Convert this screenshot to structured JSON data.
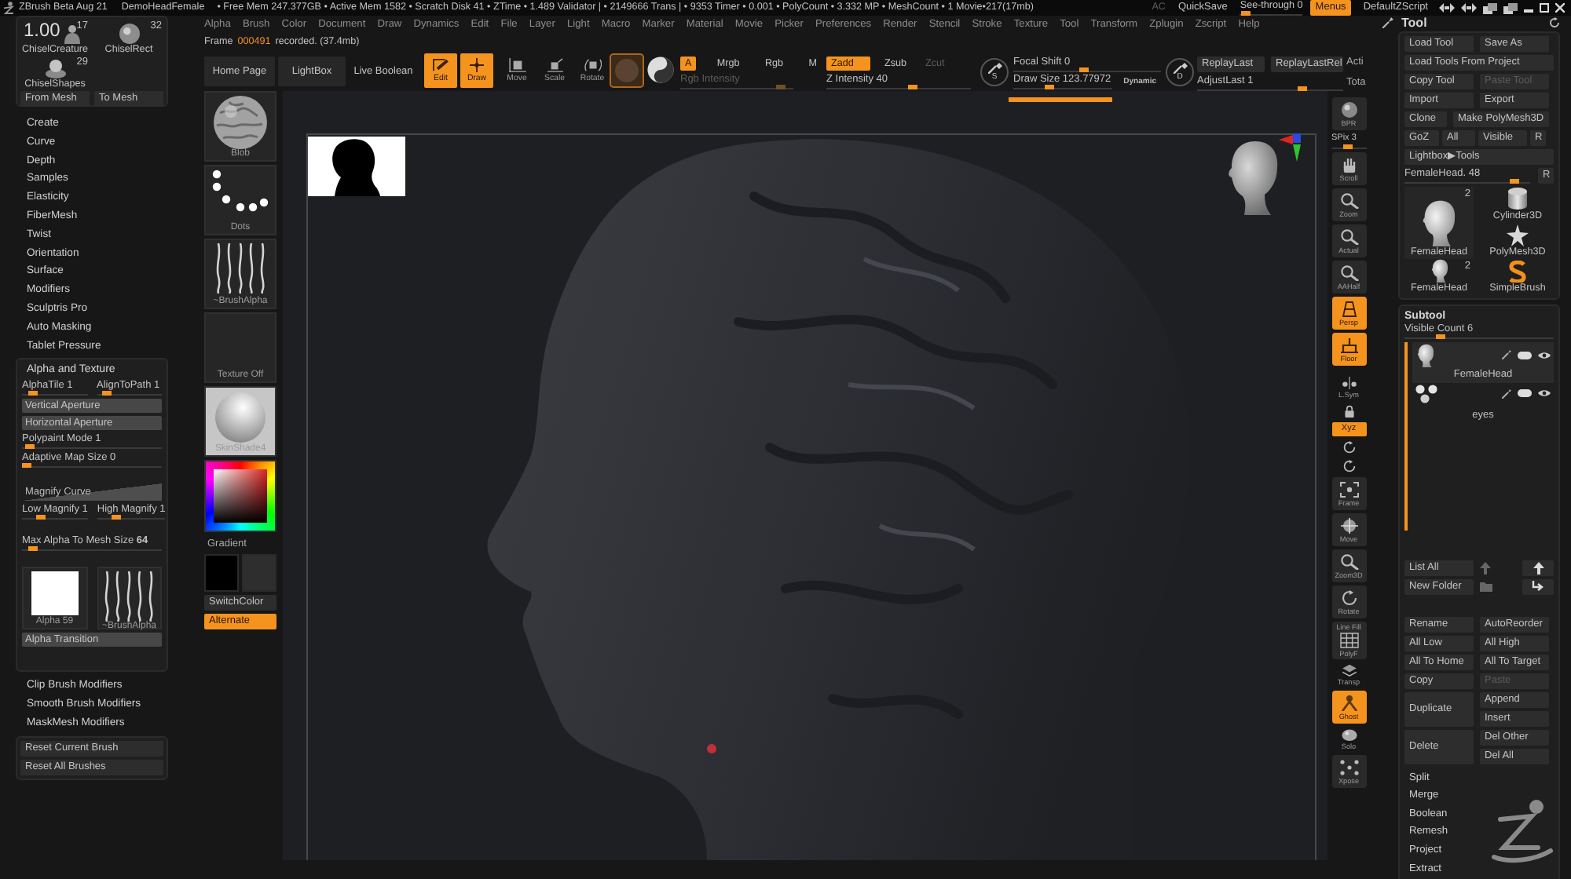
{
  "title_bar": {
    "app": "ZBrush Beta Aug 21",
    "document": "DemoHeadFemale",
    "stats": "• Free Mem 247.377GB • Active Mem 1582 • Scratch Disk 41 •  ZTime • 1.489 Validator | • 2149666 Trans | • 9353 Timer • 0.001 • PolyCount • 3.332 MP • MeshCount • 1  Movie•217(17mb)",
    "controls": [
      {
        "kind": "label",
        "label": "AC",
        "disabled": true
      },
      {
        "kind": "button",
        "label": "QuickSave",
        "on": false
      },
      {
        "kind": "slider",
        "label": "See-through 0",
        "level": 0.03
      },
      {
        "kind": "button",
        "label": "Menus",
        "on": true
      },
      {
        "kind": "button",
        "label": "DefaultZScript",
        "on": false
      }
    ]
  },
  "menu": [
    "Alpha",
    "Brush",
    "Color",
    "Document",
    "Draw",
    "Dynamics",
    "Edit",
    "File",
    "Layer",
    "Light",
    "Macro",
    "Marker",
    "Material",
    "Movie",
    "Picker",
    "Preferences",
    "Render",
    "Stencil",
    "Stroke",
    "Texture",
    "Tool",
    "Transform",
    "Zplugin",
    "Zscript",
    "Help"
  ],
  "frame_status": {
    "label": "Frame",
    "number": "000491",
    "note": "recorded. (37.4mb)"
  },
  "left_panel": {
    "readout": "1.00",
    "tools": [
      {
        "label": "ChiselCreature",
        "count": "17"
      },
      {
        "label": "ChiselRect",
        "count": "32"
      },
      {
        "label": "ChiselShapes",
        "count": "29"
      }
    ],
    "mesh_buttons": [
      "From Mesh",
      "To Mesh"
    ],
    "brush_menu": [
      "Create",
      "Curve",
      "Depth",
      "Samples",
      "Elasticity",
      "FiberMesh",
      "Twist",
      "Orientation",
      "Surface",
      "Modifiers",
      "Sculptris Pro",
      "Auto Masking",
      "Tablet Pressure"
    ],
    "alpha_texture": {
      "title": "Alpha and Texture",
      "rows": [
        [
          {
            "kind": "slider",
            "label": "AlphaTile 1",
            "level": 0.1
          },
          {
            "kind": "slider",
            "label": "AlignToPath 1",
            "level": 0.1
          }
        ],
        [
          {
            "kind": "bar",
            "label": "Vertical Aperture"
          }
        ],
        [
          {
            "kind": "bar",
            "label": "Horizontal Aperture"
          }
        ],
        [
          {
            "kind": "slider",
            "label": "Polypaint Mode 1",
            "level": 0.02
          }
        ],
        [
          {
            "kind": "slider",
            "label": "Adaptive Map Size 0",
            "level": 0.0
          }
        ],
        [
          {
            "kind": "curve",
            "label": "Magnify Curve"
          }
        ],
        [
          {
            "kind": "slider",
            "label": "Low Magnify 1",
            "level": 0.25
          },
          {
            "kind": "slider",
            "label": "High Magnify 1",
            "level": 0.25
          }
        ],
        [
          {
            "kind": "slider",
            "label": "Max Alpha To Mesh Size **64**",
            "level": 0.05
          }
        ],
        [
          {
            "kind": "solid",
            "label": "Alpha 59"
          },
          {
            "kind": "alpha",
            "label": "~BrushAlpha"
          }
        ],
        [
          {
            "kind": "bar",
            "label": "Alpha Transition"
          }
        ]
      ]
    },
    "modifiers": [
      "Clip Brush Modifiers",
      "Smooth Brush Modifiers",
      "MaskMesh Modifiers"
    ],
    "reset_buttons": [
      "Reset Current Brush",
      "Reset All Brushes"
    ]
  },
  "shelf": {
    "buttons": [
      {
        "kind": "button",
        "label": "Home Page"
      },
      {
        "kind": "button",
        "label": "LightBox"
      },
      {
        "kind": "plain",
        "label": "Live Boolean"
      }
    ],
    "modes": [
      {
        "label": "Edit",
        "selected": true
      },
      {
        "label": "Draw",
        "selected": true
      },
      {
        "label": "Move",
        "selected": false
      },
      {
        "label": "Scale",
        "selected": false
      },
      {
        "label": "Rotate",
        "selected": false
      }
    ],
    "color_modes": [
      {
        "label": "A",
        "selected": true
      },
      {
        "label": "Mrgb",
        "selected": false
      },
      {
        "label": "Rgb",
        "selected": false
      },
      {
        "label": "M",
        "selected": false
      }
    ],
    "rgb_intensity": {
      "label": "Rgb Intensity",
      "level": 0.92,
      "disabled": true
    },
    "sculpt_modes": [
      {
        "label": "Zadd",
        "selected": true,
        "disabled": false
      },
      {
        "label": "Zsub",
        "selected": false,
        "disabled": false
      },
      {
        "label": "Zcut",
        "selected": false,
        "disabled": true
      }
    ],
    "z_intensity": {
      "label": "Z Intensity 40",
      "level": 0.6
    },
    "stroke_button": "S",
    "focal_shift": {
      "label": "Focal Shift 0",
      "level": 0.48
    },
    "draw_size": {
      "label": "Draw Size 123.77972",
      "level": 0.35
    },
    "dynamic": "Dynamic",
    "alpha_button": "D",
    "replay_buttons": [
      "ReplayLast",
      "ReplayLastRel"
    ],
    "adjust_last": {
      "label": "AdjustLast 1",
      "level": 0.74
    },
    "cut_labels": [
      "Acti",
      "Tota"
    ]
  },
  "left_shelf": [
    {
      "kind": "brush",
      "label": "Blob"
    },
    {
      "kind": "stroke",
      "label": "Dots"
    },
    {
      "kind": "alpha",
      "label": "~BrushAlpha"
    },
    {
      "kind": "texture",
      "label": "Texture Off"
    },
    {
      "kind": "material",
      "label": "SkinShade4"
    },
    {
      "kind": "picker"
    },
    {
      "kind": "label",
      "label": "Gradient"
    },
    {
      "kind": "swatches",
      "swatches": [
        {
          "color": "#000000"
        },
        {
          "color": "#2e2e2e"
        }
      ]
    },
    {
      "kind": "button",
      "label": "SwitchColor",
      "on": false
    },
    {
      "kind": "button",
      "label": "Alternate",
      "on": true
    }
  ],
  "right_shelf": [
    {
      "kind": "tile",
      "label": "BPR",
      "selected": false
    },
    {
      "kind": "slider",
      "label": "SPix 3",
      "level": 0.45
    },
    {
      "kind": "tile",
      "label": "Scroll",
      "selected": false
    },
    {
      "kind": "tile",
      "label": "Zoom",
      "selected": false
    },
    {
      "kind": "tile",
      "label": "Actual",
      "selected": false
    },
    {
      "kind": "tile",
      "label": "AAHalf",
      "selected": false
    },
    {
      "kind": "tile",
      "label": "Persp",
      "selected": true
    },
    {
      "kind": "tile",
      "label": "Floor",
      "selected": true
    },
    {
      "kind": "small",
      "label": "L.Sym",
      "selected": false
    },
    {
      "kind": "small",
      "selected": false
    },
    {
      "kind": "chip",
      "label": "Xyz",
      "selected": true
    },
    {
      "kind": "small",
      "selected": false
    },
    {
      "kind": "small",
      "selected": false
    },
    {
      "kind": "tile",
      "label": "Frame",
      "selected": false
    },
    {
      "kind": "tile",
      "label": "Move",
      "selected": false
    },
    {
      "kind": "tile",
      "label": "Zoom3D",
      "selected": false
    },
    {
      "kind": "tile",
      "label": "Rotate",
      "selected": false
    },
    {
      "kind": "tile",
      "caption": "Line Fill",
      "label": "PolyF",
      "selected": false
    },
    {
      "kind": "small",
      "label": "Transp",
      "selected": false
    },
    {
      "kind": "tile",
      "label": "Ghost",
      "selected": true
    },
    {
      "kind": "small",
      "label": "Solo",
      "selected": false
    },
    {
      "kind": "tile",
      "label": "Xpose",
      "selected": false
    }
  ],
  "tool_palette": {
    "title": "Tool",
    "rows": [
      [
        {
          "label": "Load Tool",
          "disabled": false
        },
        {
          "label": "Save As",
          "disabled": false
        }
      ],
      [
        {
          "label": "Load Tools From Project",
          "disabled": false
        }
      ],
      [
        {
          "label": "Copy Tool",
          "disabled": false
        },
        {
          "label": "Paste Tool",
          "disabled": true
        }
      ],
      [
        {
          "label": "Import",
          "disabled": false
        },
        {
          "label": "Export",
          "disabled": false
        }
      ],
      [
        {
          "label": "Clone",
          "disabled": false
        },
        {
          "label": "Make PolyMesh3D",
          "disabled": false
        }
      ],
      [
        {
          "label": "GoZ",
          "disabled": false
        },
        {
          "label": "All",
          "disabled": false
        },
        {
          "label": "Visible",
          "disabled": false
        },
        {
          "label": "R",
          "disabled": false
        }
      ],
      [
        {
          "label": "Lightbox▶Tools",
          "disabled": false
        }
      ]
    ],
    "tool_slider": {
      "label": "FemaleHead. 48",
      "level": 0.9
    },
    "tool_slider_button": "R",
    "thumbs": [
      {
        "kind": "head",
        "label": "FemaleHead",
        "count": "2",
        "selected": true
      },
      {
        "kind": "cylinder",
        "label": "Cylinder3D",
        "selected": false
      },
      {
        "kind": "star",
        "label": "PolyMesh3D",
        "selected": false
      },
      {
        "kind": "head",
        "label": "FemaleHead",
        "count": "2",
        "selected": false
      },
      {
        "kind": "swirl",
        "label": "SimpleBrush",
        "selected": false
      }
    ],
    "subtool": {
      "title": "Subtool",
      "visible_count": {
        "label": "Visible Count 6",
        "level": 0.22
      },
      "items": [
        {
          "kind": "head",
          "label": "FemaleHead",
          "selected": true
        },
        {
          "kind": "spheres",
          "label": "eyes",
          "selected": false
        }
      ]
    },
    "list_buttons": [
      "List All",
      "New Folder"
    ],
    "actions": [
      [
        {
          "label": "Rename",
          "disabled": false
        },
        {
          "label": "AutoReorder",
          "disabled": false
        }
      ],
      [
        {
          "label": "All Low",
          "disabled": false
        },
        {
          "label": "All High",
          "disabled": false
        }
      ],
      [
        {
          "label": "All To Home",
          "disabled": false
        },
        {
          "label": "All To Target",
          "disabled": false
        }
      ],
      [
        {
          "label": "Copy",
          "disabled": false
        },
        {
          "label": "Paste",
          "disabled": true
        }
      ]
    ],
    "groups": [
      {
        "label": "Duplicate",
        "options": [
          "Append",
          "Insert"
        ]
      },
      {
        "label": "Delete",
        "options": [
          "Del Other",
          "Del All"
        ]
      }
    ],
    "commands": [
      "Split",
      "Merge",
      "Boolean",
      "Remesh",
      "Project",
      "Extract"
    ]
  }
}
